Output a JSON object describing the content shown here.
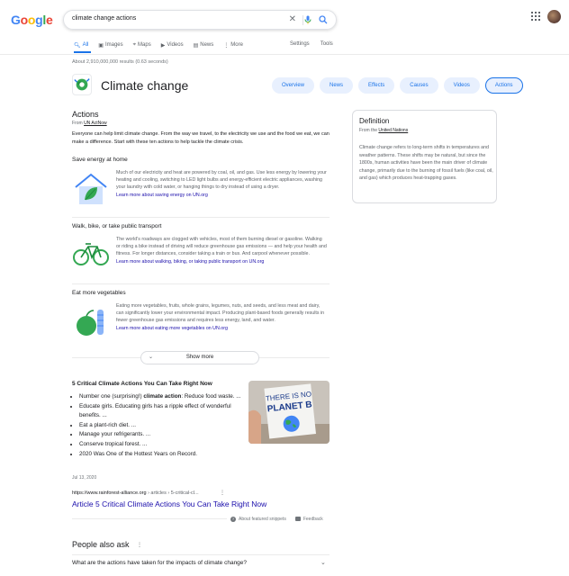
{
  "logo": {
    "letters": [
      "G",
      "o",
      "o",
      "g",
      "l",
      "e"
    ]
  },
  "search": {
    "query": "climate change actions"
  },
  "tabs": [
    {
      "label": "All",
      "icon": "search-icon"
    },
    {
      "label": "Images",
      "icon": "image-icon"
    },
    {
      "label": "Maps",
      "icon": "map-pin-icon"
    },
    {
      "label": "Videos",
      "icon": "video-icon"
    },
    {
      "label": "News",
      "icon": "newspaper-icon"
    },
    {
      "label": "More",
      "icon": "more-vert-icon"
    }
  ],
  "tools": {
    "settings": "Settings",
    "tools": "Tools"
  },
  "stats": "About 2,910,000,000 results (0.63 seconds)",
  "knowledge_panel": {
    "title": "Climate change",
    "chips": [
      "Overview",
      "News",
      "Effects",
      "Causes",
      "Videos",
      "Actions"
    ],
    "selected_chip": "Actions"
  },
  "actions": {
    "heading": "Actions",
    "from_prefix": "From ",
    "from_source": "UN ActNow",
    "lead": "Everyone can help limit climate change. From the way we travel, to the electricity we use and the food we eat, we can make a difference. Start with these ten actions to help tackle the climate crisis.",
    "items": [
      {
        "title": "Save energy at home",
        "text": "Much of our electricity and heat are powered by coal, oil, and gas. Use less energy by lowering your heating and cooling, switching to LED light bulbs and energy-efficient electric appliances, washing your laundry with cold water, or hanging things to dry instead of using a dryer.",
        "link": "Learn more about saving energy on UN.org"
      },
      {
        "title": "Walk, bike, or take public transport",
        "text": "The world's roadways are clogged with vehicles, most of them burning diesel or gasoline. Walking or riding a bike instead of driving will reduce greenhouse gas emissions — and help your health and fitness. For longer distances, consider taking a train or bus. And carpool whenever possible.",
        "link": "Learn more about walking, biking, or taking public transport on UN.org"
      },
      {
        "title": "Eat more vegetables",
        "text": "Eating more vegetables, fruits, whole grains, legumes, nuts, and seeds, and less meat and dairy, can significantly lower your environmental impact. Producing plant-based foods generally results in fewer greenhouse gas emissions and requires less energy, land, and water.",
        "link": "Learn more about eating more vegetables on UN.org"
      }
    ],
    "show_more": "Show more"
  },
  "definition": {
    "title": "Definition",
    "from_prefix": "From the ",
    "from_source": "United Nations",
    "text": "Climate change refers to long-term shifts in temperatures and weather patterns. These shifts may be natural, but since the 1800s, human activities have been the main driver of climate change, primarily due to the burning of fossil fuels (like coal, oil, and gas) which produces heat-trapping gases."
  },
  "snippet": {
    "title": "5 Critical Climate Actions You Can Take Right Now",
    "first_item_pre": "Number one (surprising!) ",
    "first_item_bold": "climate action",
    "first_item_post": ": Reduce food waste. ...",
    "items": [
      "Educate girls. Educating girls has a ripple effect of wonderful benefits. ...",
      "Eat a plant-rich diet. ...",
      "Manage your refrigerants. ...",
      "Conserve tropical forest. ...",
      "2020 Was One of the Hottest Years on Record."
    ],
    "date": "Jul 13, 2020",
    "image_sign_text": "THERE IS NO PLANET B",
    "url_domain": "https://www.rainforest-alliance.org",
    "url_path": " › articles › 5-critical-cl...",
    "link": "Article 5 Critical Climate Actions You Can Take Right Now",
    "about": "About featured snippets",
    "feedback": "Feedback"
  },
  "paa": {
    "title": "People also ask",
    "question": "What are the actions have taken for the impacts of climate change?"
  }
}
